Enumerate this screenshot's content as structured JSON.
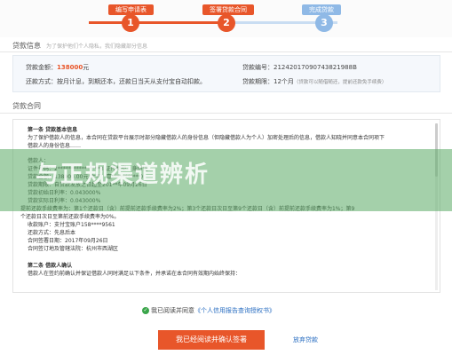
{
  "stepper": {
    "steps": [
      {
        "label": "编写申请表",
        "number": "1"
      },
      {
        "label": "签署贷款合同",
        "number": "2"
      },
      {
        "label": "完成贷款",
        "number": "3"
      }
    ],
    "colors": {
      "active": "#e8562a",
      "inactive": "#8fb9e6"
    }
  },
  "loan_info": {
    "title": "贷款信息",
    "subtitle": "为了保护他们个人隐私，我们隐藏部分信息",
    "amount_label": "贷款金额：",
    "amount_value": "138000",
    "amount_unit": "元",
    "number_label": "贷款编号：",
    "number_value": "21242017090743821988B",
    "repay_label": "还款方式：",
    "repay_value": "按月计息，到期还本，还款日当天从支付宝自动扣款。",
    "term_label": "贷款期限：",
    "term_value": "12个月",
    "term_hint": "（贷款可以随借随还，提前还款免手续费）"
  },
  "contract": {
    "title": "贷款合同",
    "lines": [
      "第一条 贷款基本信息",
      "为了保护借款人的信息，本合同在贷款平台展示时部分隐藏借款人的身份信息（但隐藏借款人为个人）加密处理后的信息，借款人知晓并同意本合同项下",
      "借款人的身份信息……",
      "借款人：",
      "证件号码：2****************3       证件类型：身份证",
      "贷款金额：138000.00元(大写：壹***********)",
      "贷款期限：自贷款发放之日起至201**年09月26日",
      "贷款初始日利率：0.043000%",
      "贷款实际日利率：0.043000%",
      "提前还款手续费率为：第1个还款日（含）前提前还款手续费率为2%；第3个还款日次日至第9个还款日（含）前提前还款手续费率为1%；第9",
      "个还款日次日至第前还款手续费率为0%。",
      "收款账户：支付宝账户158****9561",
      "还款方式：先息后本",
      "合同签署日期：2017年09月26日",
      "合同签订地及管辖法院：杭州市西湖区",
      "第二条 借款人确认",
      "借款人在签约前确认并保证借款人同时满足以下条件，并承诺在本合同有效期内始终保持："
    ]
  },
  "watermark": {
    "text": "与正规渠道辨析"
  },
  "agree": {
    "check_glyph": "✓",
    "text": "我已阅读并同意",
    "link": "《个人信用报告查询授权书》"
  },
  "actions": {
    "confirm": "我已经阅读并确认签署",
    "cancel": "放弃贷款"
  }
}
